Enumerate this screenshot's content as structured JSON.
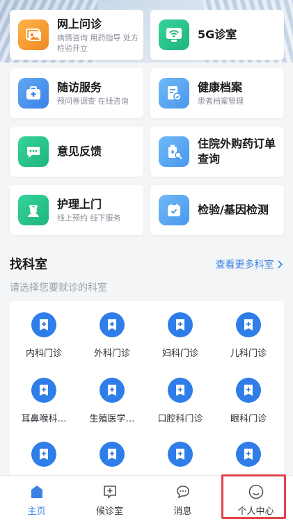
{
  "services": [
    {
      "title": "网上问诊",
      "subtitle": "病情咨询 用药指导 处方 检验开立",
      "icon": "photo-icon",
      "color": "#f08a24"
    },
    {
      "title": "5G诊室",
      "subtitle": "",
      "icon": "wifi-icon",
      "color": "#1fb57d"
    },
    {
      "title": "随访服务",
      "subtitle": "预问卷调查 在线咨询",
      "icon": "medkit-icon",
      "color": "#3b82e6"
    },
    {
      "title": "健康档案",
      "subtitle": "患者档案管理",
      "icon": "health-file-icon",
      "color": "#3b82e6"
    },
    {
      "title": "意见反馈",
      "subtitle": "",
      "icon": "chat-icon",
      "color": "#1fb57d"
    },
    {
      "title": "住院外购药订单查询",
      "subtitle": "",
      "icon": "medicine-search-icon",
      "color": "#3b82e6"
    },
    {
      "title": "护理上门",
      "subtitle": "线上预约 线下服务",
      "icon": "nurse-icon",
      "color": "#1fb57d"
    },
    {
      "title": "检验/基因检测",
      "subtitle": "",
      "icon": "calendar-check-icon",
      "color": "#3b82e6"
    }
  ],
  "dept": {
    "title": "找科室",
    "more": "查看更多科室",
    "subtitle": "请选择您要就诊的科室",
    "items": [
      "内科门诊",
      "外科门诊",
      "妇科门诊",
      "儿科门诊",
      "耳鼻喉科…",
      "生殖医学…",
      "口腔科门诊",
      "眼科门诊",
      "",
      "",
      "",
      ""
    ]
  },
  "tabs": [
    {
      "label": "主页",
      "icon": "home-icon"
    },
    {
      "label": "候诊室",
      "icon": "waiting-room-icon"
    },
    {
      "label": "消息",
      "icon": "message-icon"
    },
    {
      "label": "个人中心",
      "icon": "profile-icon"
    }
  ],
  "colors": {
    "accent": "#3b82e6",
    "highlight": "#e2434b",
    "dept_icon": "#2f7de8"
  }
}
